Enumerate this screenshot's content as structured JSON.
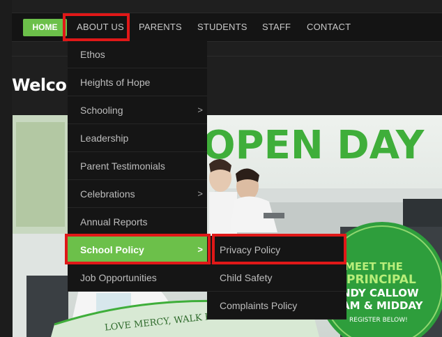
{
  "nav": {
    "items": [
      {
        "label": "HOME"
      },
      {
        "label": "ABOUT US"
      },
      {
        "label": "PARENTS"
      },
      {
        "label": "STUDENTS"
      },
      {
        "label": "STAFF"
      },
      {
        "label": "CONTACT"
      }
    ]
  },
  "page": {
    "welcome_heading": "Welco"
  },
  "dropdown": {
    "items": [
      {
        "label": "Ethos"
      },
      {
        "label": "Heights of Hope"
      },
      {
        "label": "Schooling",
        "arrow": ">"
      },
      {
        "label": "Leadership"
      },
      {
        "label": "Parent Testimonials"
      },
      {
        "label": "Celebrations",
        "arrow": ">"
      },
      {
        "label": "Annual Reports"
      },
      {
        "label": "School Policy",
        "arrow": ">"
      },
      {
        "label": "Job Opportunities"
      }
    ]
  },
  "submenu": {
    "items": [
      {
        "label": "Privacy Policy"
      },
      {
        "label": "Child Safety"
      },
      {
        "label": "Complaints Policy"
      }
    ]
  },
  "banner": {
    "headline": "OPEN DAY",
    "badge_line1": "MEET THE",
    "badge_line2": "PRINCIPAL",
    "badge_line3": "NDY CALLOW",
    "badge_line4": "AM & MIDDAY",
    "badge_line5": "REGISTER BELOW!",
    "ribbon_text": "LOVE MERCY, WALK HUMBLY"
  },
  "colors": {
    "accent_green": "#6cc04a",
    "highlight_red": "#e01818",
    "headline_green": "#3fae3a"
  }
}
